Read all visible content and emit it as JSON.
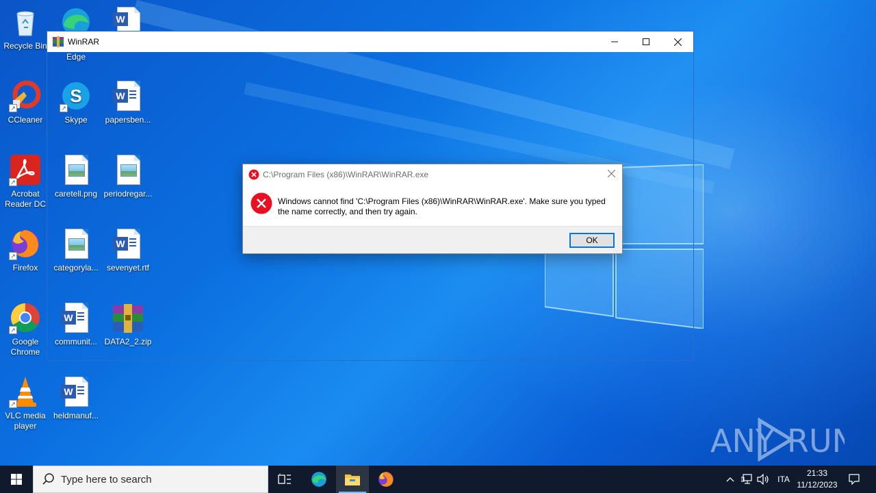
{
  "desktop": {
    "icons": [
      {
        "label": "Recycle Bin"
      },
      {
        "label": "Edge"
      },
      {
        "label": "CCleaner"
      },
      {
        "label": "Skype"
      },
      {
        "label": "papersben..."
      },
      {
        "label": "Acrobat Reader DC"
      },
      {
        "label": "caretell.png"
      },
      {
        "label": "periodregar..."
      },
      {
        "label": "Firefox"
      },
      {
        "label": "categoryla..."
      },
      {
        "label": "sevenyet.rtf"
      },
      {
        "label": "Google Chrome"
      },
      {
        "label": "communit..."
      },
      {
        "label": "DATA2_2.zip"
      },
      {
        "label": "VLC media player"
      },
      {
        "label": "heldmanuf..."
      }
    ]
  },
  "winrar_window": {
    "title": "WinRAR",
    "minimize": "—",
    "maximize": "☐",
    "close": "✕"
  },
  "error_dialog": {
    "title": "C:\\Program Files (x86)\\WinRAR\\WinRAR.exe",
    "message": "Windows cannot find 'C:\\Program Files (x86)\\WinRAR\\WinRAR.exe'. Make sure you typed the name correctly, and then try again.",
    "ok_label": "OK",
    "close": "✕"
  },
  "watermark": {
    "text": "ANY RUN"
  },
  "taskbar": {
    "search_placeholder": "Type here to search",
    "language": "ITA",
    "time": "21:33",
    "date": "11/12/2023"
  },
  "colors": {
    "accent": "#0078d7",
    "taskbar": "#101a2c",
    "error_red": "#e81123"
  }
}
